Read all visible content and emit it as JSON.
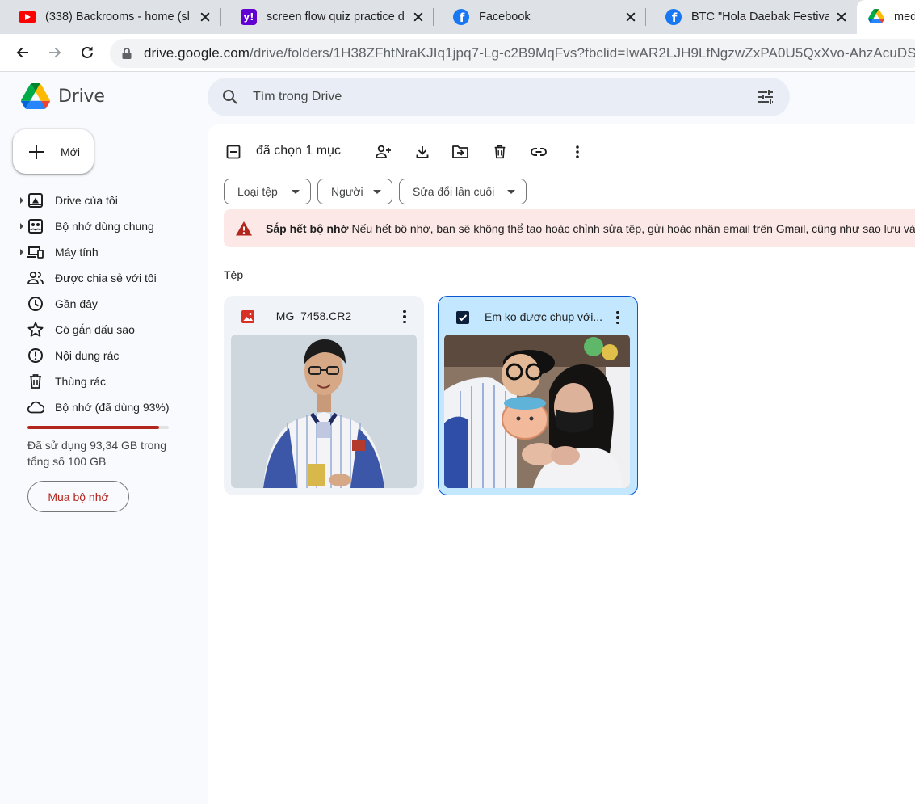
{
  "browser": {
    "tabs": [
      {
        "title": "(338) Backrooms - home (sl",
        "favicon": "youtube-icon"
      },
      {
        "title": "screen flow quiz practice di",
        "favicon": "yahoo-icon"
      },
      {
        "title": "Facebook",
        "favicon": "facebook-icon"
      },
      {
        "title": "BTC \"Hola Daebak Festival\"",
        "favicon": "facebook-icon"
      },
      {
        "title": "med",
        "favicon": "google-drive-icon"
      }
    ],
    "url_host": "drive.google.com",
    "url_path": "/drive/folders/1H38ZFhtNraKJIq1jpq7-Lg-c2B9MqFvs?fbclid=IwAR2LJH9LfNgzwZxPA0U5QxXvo-AhzAcuDS"
  },
  "header": {
    "app_name": "Drive",
    "search_placeholder": "Tìm trong Drive"
  },
  "sidebar": {
    "new_label": "Mới",
    "items": [
      {
        "label": "Drive của tôi",
        "icon": "my-drive-icon",
        "expandable": true
      },
      {
        "label": "Bộ nhớ dùng chung",
        "icon": "shared-drives-icon",
        "expandable": true
      },
      {
        "label": "Máy tính",
        "icon": "computers-icon",
        "expandable": true
      },
      {
        "label": "Được chia sẻ với tôi",
        "icon": "shared-with-me-icon",
        "expandable": false
      },
      {
        "label": "Gần đây",
        "icon": "clock-icon",
        "expandable": false
      },
      {
        "label": "Có gắn dấu sao",
        "icon": "star-icon",
        "expandable": false
      },
      {
        "label": "Nội dung rác",
        "icon": "spam-icon",
        "expandable": false
      },
      {
        "label": "Thùng rác",
        "icon": "trash-icon",
        "expandable": false
      },
      {
        "label": "Bộ nhớ (đã dùng 93%)",
        "icon": "cloud-icon",
        "expandable": false
      }
    ],
    "storage_used_fraction": 0.93,
    "storage_text": "Đã sử dụng 93,34 GB trong tổng số 100 GB",
    "buy_storage_label": "Mua bộ nhớ"
  },
  "main": {
    "selection_count": "đã chọn 1 mục",
    "filters": [
      "Loại tệp",
      "Người",
      "Sửa đổi lần cuối"
    ],
    "alert": {
      "title": "Sắp hết bộ nhớ",
      "body": "Nếu hết bộ nhớ, bạn sẽ không thể tạo hoặc chỉnh sửa tệp, gửi hoặc nhận email trên Gmail, cũng như sao lưu vào"
    },
    "section_label": "Tệp",
    "files": [
      {
        "name": "_MG_7458.CR2",
        "type_icon": "image-file-icon",
        "selected": false
      },
      {
        "name": "Em ko được chụp với...",
        "type_icon": "checkbox-checked-icon",
        "selected": true
      }
    ]
  },
  "colors": {
    "accent_blue": "#0b57d0",
    "selected_card": "#c2e7ff",
    "warning_red": "#b3261e",
    "alert_bg": "#fce8e6",
    "search_bg": "#e9eef6"
  }
}
